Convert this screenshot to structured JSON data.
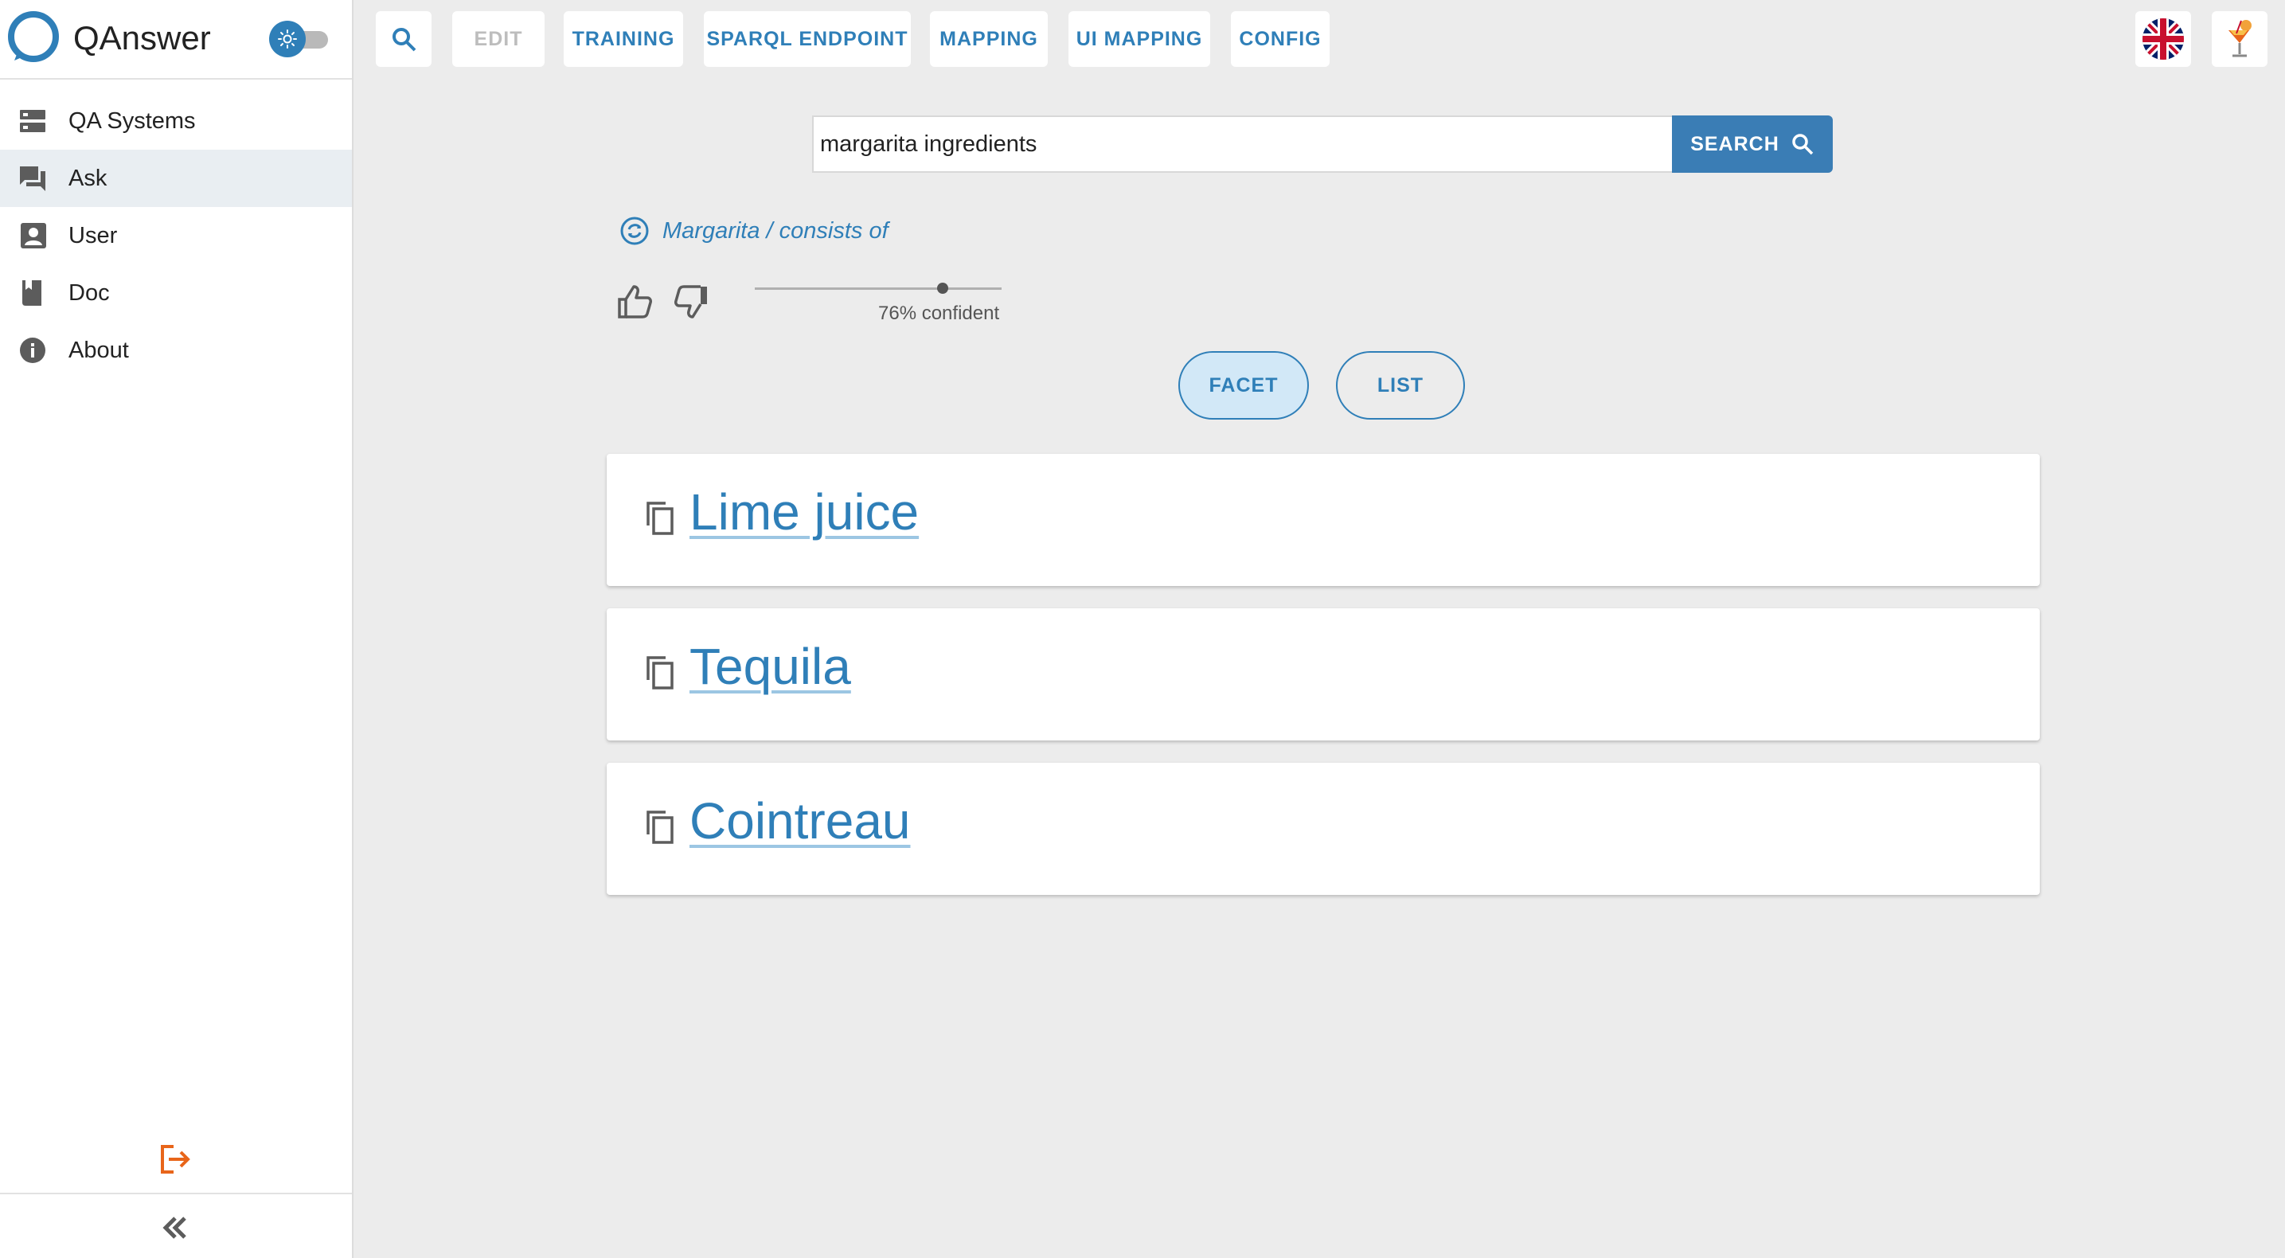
{
  "app": {
    "name": "QAnswer"
  },
  "sidebar": {
    "items": [
      {
        "label": "QA Systems",
        "icon": "storage-icon",
        "active": false
      },
      {
        "label": "Ask",
        "icon": "forum-icon",
        "active": true
      },
      {
        "label": "User",
        "icon": "account-box-icon",
        "active": false
      },
      {
        "label": "Doc",
        "icon": "book-icon",
        "active": false
      },
      {
        "label": "About",
        "icon": "info-icon",
        "active": false
      }
    ],
    "logout_icon": "logout-icon",
    "collapse_icon": "double-chevron-left-icon",
    "logout_color": "#e8651a"
  },
  "toolbar": {
    "search_icon": "search-icon",
    "buttons": [
      {
        "label": "EDIT",
        "disabled": true
      },
      {
        "label": "TRAINING",
        "disabled": false
      },
      {
        "label": "SPARQL ENDPOINT",
        "disabled": false
      },
      {
        "label": "MAPPING",
        "disabled": false
      },
      {
        "label": "UI MAPPING",
        "disabled": false
      },
      {
        "label": "CONFIG",
        "disabled": false
      }
    ],
    "language_icon": "uk-flag-icon",
    "dataset_icon": "cocktail-icon"
  },
  "search": {
    "query": "margarita ingredients",
    "button_label": "SEARCH"
  },
  "interpretation": {
    "text": "Margarita / consists of",
    "confidence_value": 0.76,
    "confidence_label": "76% confident"
  },
  "view_toggle": {
    "facet_label": "FACET",
    "list_label": "LIST",
    "selected": "FACET"
  },
  "results": [
    {
      "label": "Lime juice"
    },
    {
      "label": "Tequila"
    },
    {
      "label": "Cointreau"
    }
  ],
  "colors": {
    "accent": "#2f7fb8",
    "background": "#ececec",
    "selected_pill": "#d2e8f7"
  }
}
